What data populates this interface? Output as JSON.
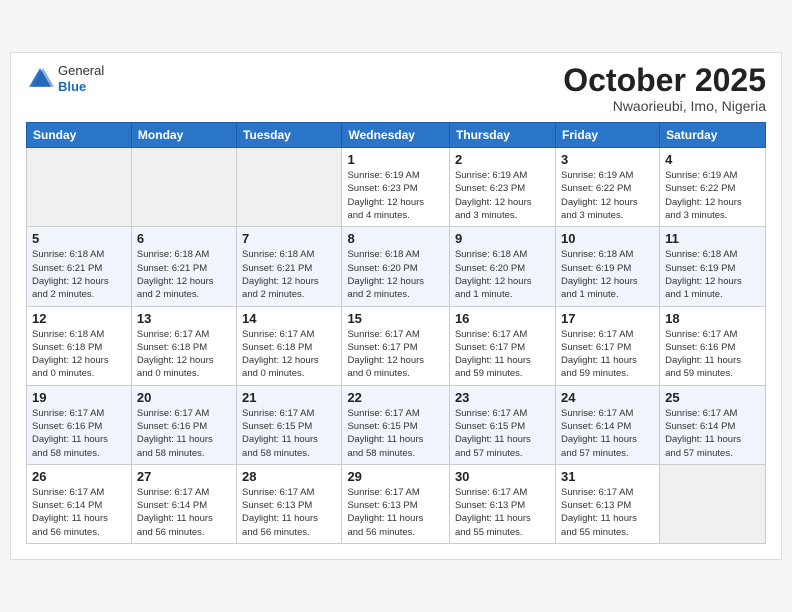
{
  "header": {
    "logo_general": "General",
    "logo_blue": "Blue",
    "month_title": "October 2025",
    "location": "Nwaorieubi, Imo, Nigeria"
  },
  "weekdays": [
    "Sunday",
    "Monday",
    "Tuesday",
    "Wednesday",
    "Thursday",
    "Friday",
    "Saturday"
  ],
  "weeks": [
    [
      {
        "day": "",
        "info": ""
      },
      {
        "day": "",
        "info": ""
      },
      {
        "day": "",
        "info": ""
      },
      {
        "day": "1",
        "info": "Sunrise: 6:19 AM\nSunset: 6:23 PM\nDaylight: 12 hours\nand 4 minutes."
      },
      {
        "day": "2",
        "info": "Sunrise: 6:19 AM\nSunset: 6:23 PM\nDaylight: 12 hours\nand 3 minutes."
      },
      {
        "day": "3",
        "info": "Sunrise: 6:19 AM\nSunset: 6:22 PM\nDaylight: 12 hours\nand 3 minutes."
      },
      {
        "day": "4",
        "info": "Sunrise: 6:19 AM\nSunset: 6:22 PM\nDaylight: 12 hours\nand 3 minutes."
      }
    ],
    [
      {
        "day": "5",
        "info": "Sunrise: 6:18 AM\nSunset: 6:21 PM\nDaylight: 12 hours\nand 2 minutes."
      },
      {
        "day": "6",
        "info": "Sunrise: 6:18 AM\nSunset: 6:21 PM\nDaylight: 12 hours\nand 2 minutes."
      },
      {
        "day": "7",
        "info": "Sunrise: 6:18 AM\nSunset: 6:21 PM\nDaylight: 12 hours\nand 2 minutes."
      },
      {
        "day": "8",
        "info": "Sunrise: 6:18 AM\nSunset: 6:20 PM\nDaylight: 12 hours\nand 2 minutes."
      },
      {
        "day": "9",
        "info": "Sunrise: 6:18 AM\nSunset: 6:20 PM\nDaylight: 12 hours\nand 1 minute."
      },
      {
        "day": "10",
        "info": "Sunrise: 6:18 AM\nSunset: 6:19 PM\nDaylight: 12 hours\nand 1 minute."
      },
      {
        "day": "11",
        "info": "Sunrise: 6:18 AM\nSunset: 6:19 PM\nDaylight: 12 hours\nand 1 minute."
      }
    ],
    [
      {
        "day": "12",
        "info": "Sunrise: 6:18 AM\nSunset: 6:18 PM\nDaylight: 12 hours\nand 0 minutes."
      },
      {
        "day": "13",
        "info": "Sunrise: 6:17 AM\nSunset: 6:18 PM\nDaylight: 12 hours\nand 0 minutes."
      },
      {
        "day": "14",
        "info": "Sunrise: 6:17 AM\nSunset: 6:18 PM\nDaylight: 12 hours\nand 0 minutes."
      },
      {
        "day": "15",
        "info": "Sunrise: 6:17 AM\nSunset: 6:17 PM\nDaylight: 12 hours\nand 0 minutes."
      },
      {
        "day": "16",
        "info": "Sunrise: 6:17 AM\nSunset: 6:17 PM\nDaylight: 11 hours\nand 59 minutes."
      },
      {
        "day": "17",
        "info": "Sunrise: 6:17 AM\nSunset: 6:17 PM\nDaylight: 11 hours\nand 59 minutes."
      },
      {
        "day": "18",
        "info": "Sunrise: 6:17 AM\nSunset: 6:16 PM\nDaylight: 11 hours\nand 59 minutes."
      }
    ],
    [
      {
        "day": "19",
        "info": "Sunrise: 6:17 AM\nSunset: 6:16 PM\nDaylight: 11 hours\nand 58 minutes."
      },
      {
        "day": "20",
        "info": "Sunrise: 6:17 AM\nSunset: 6:16 PM\nDaylight: 11 hours\nand 58 minutes."
      },
      {
        "day": "21",
        "info": "Sunrise: 6:17 AM\nSunset: 6:15 PM\nDaylight: 11 hours\nand 58 minutes."
      },
      {
        "day": "22",
        "info": "Sunrise: 6:17 AM\nSunset: 6:15 PM\nDaylight: 11 hours\nand 58 minutes."
      },
      {
        "day": "23",
        "info": "Sunrise: 6:17 AM\nSunset: 6:15 PM\nDaylight: 11 hours\nand 57 minutes."
      },
      {
        "day": "24",
        "info": "Sunrise: 6:17 AM\nSunset: 6:14 PM\nDaylight: 11 hours\nand 57 minutes."
      },
      {
        "day": "25",
        "info": "Sunrise: 6:17 AM\nSunset: 6:14 PM\nDaylight: 11 hours\nand 57 minutes."
      }
    ],
    [
      {
        "day": "26",
        "info": "Sunrise: 6:17 AM\nSunset: 6:14 PM\nDaylight: 11 hours\nand 56 minutes."
      },
      {
        "day": "27",
        "info": "Sunrise: 6:17 AM\nSunset: 6:14 PM\nDaylight: 11 hours\nand 56 minutes."
      },
      {
        "day": "28",
        "info": "Sunrise: 6:17 AM\nSunset: 6:13 PM\nDaylight: 11 hours\nand 56 minutes."
      },
      {
        "day": "29",
        "info": "Sunrise: 6:17 AM\nSunset: 6:13 PM\nDaylight: 11 hours\nand 56 minutes."
      },
      {
        "day": "30",
        "info": "Sunrise: 6:17 AM\nSunset: 6:13 PM\nDaylight: 11 hours\nand 55 minutes."
      },
      {
        "day": "31",
        "info": "Sunrise: 6:17 AM\nSunset: 6:13 PM\nDaylight: 11 hours\nand 55 minutes."
      },
      {
        "day": "",
        "info": ""
      }
    ]
  ]
}
